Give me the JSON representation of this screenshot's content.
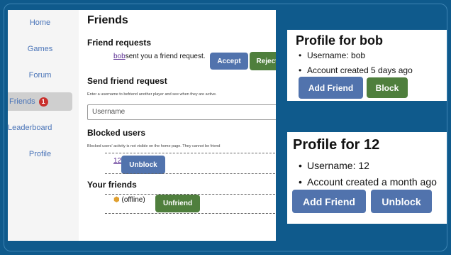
{
  "sidebar": {
    "items": [
      {
        "label": "Home"
      },
      {
        "label": "Games"
      },
      {
        "label": "Forum"
      },
      {
        "label": "Friends",
        "badge": "1"
      },
      {
        "label": "Leaderboard"
      },
      {
        "label": "Profile"
      }
    ]
  },
  "friends_page": {
    "title": "Friends",
    "requests": {
      "heading": "Friend requests",
      "user": "bob",
      "message": "sent you a friend request.",
      "accept": "Accept",
      "reject": "Reject"
    },
    "send": {
      "heading": "Send friend request",
      "description": "Enter a username to befriend another player and see when they are active.",
      "placeholder": "Username"
    },
    "blocked": {
      "heading": "Blocked users",
      "description": "Blocked users' activity is not visible on the home page. They cannot be friend",
      "user": "12",
      "unblock": "Unblock"
    },
    "friends": {
      "heading": "Your friends",
      "status": "(offline)",
      "unfriend": "Unfriend"
    }
  },
  "profile_bob": {
    "title": "Profile for bob",
    "username": "Username: bob",
    "created": "Account created 5 days ago",
    "add_friend": "Add Friend",
    "block": "Block"
  },
  "profile_12": {
    "title": "Profile for 12",
    "username": "Username: 12",
    "created": "Account created a month ago",
    "add_friend": "Add Friend",
    "unblock": "Unblock"
  },
  "colors": {
    "background": "#0f5a8c",
    "button_blue": "#5173ad",
    "button_green": "#4f7f3d",
    "badge_red": "#c9302c",
    "sidebar_link": "#4a74b8"
  }
}
